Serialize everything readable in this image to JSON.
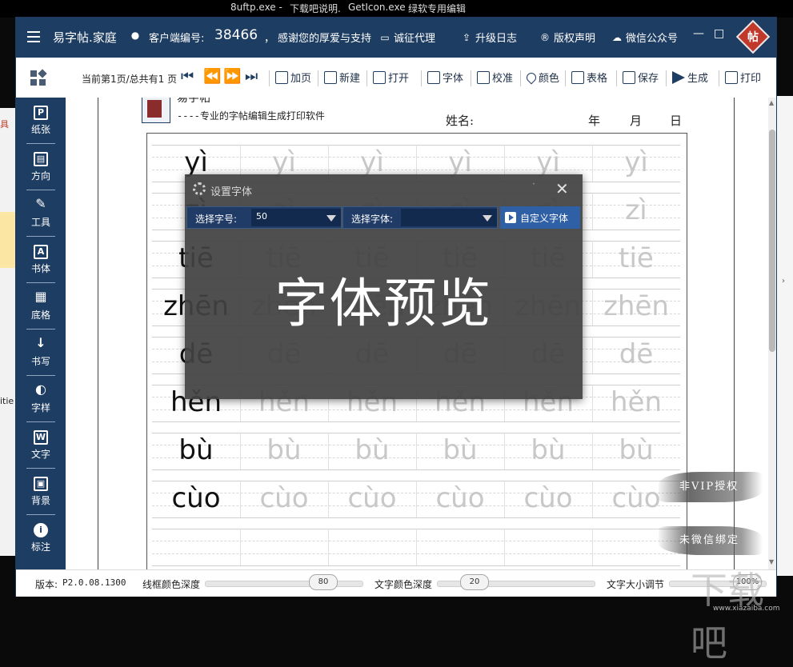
{
  "desktop": {
    "items": [
      "8uftp.exe -",
      "下载吧说明.",
      "GetIcon.exe",
      "绿软专用编辑"
    ]
  },
  "background_window": {
    "left_fragment_1": "具",
    "left_fragment_2": "itie",
    "right_chevron": "›"
  },
  "title_bar": {
    "app_name": "易字帖.家庭",
    "customer_label": "客户端编号:",
    "customer_id": "38466",
    "thanks": "感谢您的厚爱与支持",
    "links": [
      "诚征代理",
      "升级日志",
      "版权声明",
      "微信公众号"
    ],
    "minimize": "—",
    "maximize": "□",
    "logo_char": "帖"
  },
  "toolbar": {
    "page_info": "当前第1页/总共有1 页",
    "nav_first": "⏮",
    "nav_prev": "⏪",
    "nav_next": "⏩",
    "nav_last": "⏭",
    "buttons": [
      "加页",
      "新建",
      "打开",
      "字体",
      "校准",
      "颜色",
      "表格",
      "保存",
      "生成",
      "打印"
    ]
  },
  "sidebar": {
    "items": [
      {
        "label": "纸张",
        "glyph": "P"
      },
      {
        "label": "方向",
        "glyph": "▤"
      },
      {
        "label": "工具",
        "glyph": "✎"
      },
      {
        "label": "书体",
        "glyph": "A"
      },
      {
        "label": "底格",
        "glyph": "▦"
      },
      {
        "label": "书写",
        "glyph": "↓"
      },
      {
        "label": "字样",
        "glyph": "◐"
      },
      {
        "label": "文字",
        "glyph": "W"
      },
      {
        "label": "背景",
        "glyph": "▣"
      },
      {
        "label": "标注",
        "glyph": "i"
      }
    ]
  },
  "sheet": {
    "header_title": "易字帖",
    "slogan": "----专业的字帖编辑生成打印软件",
    "name_label": "姓名:",
    "year": "年",
    "month": "月",
    "day": "日",
    "rows": [
      "yì",
      "zì",
      "tiē",
      "zhēn",
      "dē",
      "hěn",
      "bù",
      "cùo",
      "",
      ""
    ],
    "vip_notice": "非VIP授权",
    "wechat_notice": "未微信绑定"
  },
  "status_bar": {
    "version_label": "版本:",
    "version": "P2.0.08.1300",
    "frame_color_label": "线框颜色深度",
    "frame_color_value": "80",
    "text_color_label": "文字颜色深度",
    "text_color_value": "20",
    "size_label": "文字大小调节",
    "size_value": "100%"
  },
  "font_dialog": {
    "title": "设置字体",
    "size_label": "选择字号:",
    "size_value": "50",
    "font_label": "选择字体:",
    "font_value": "",
    "custom_font_button": "自定义字体",
    "preview_text": "字体预览",
    "close": "✕"
  },
  "watermark": {
    "big": "下载吧",
    "url": "www.xiazaiba.com"
  },
  "colors": {
    "navy": "#1e3d62",
    "dialog_bg": "#424242",
    "select_bg": "#1f3b66",
    "custom_btn": "#2f5fa5"
  }
}
